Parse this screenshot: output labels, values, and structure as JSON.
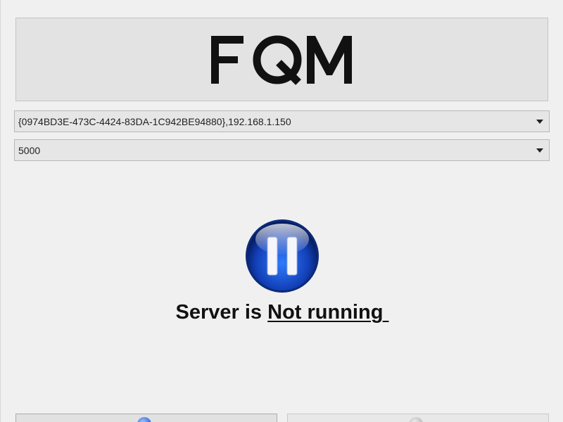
{
  "app": {
    "logo_text": "FQM"
  },
  "adapter_select": {
    "value": "{0974BD3E-473C-4424-83DA-1C942BE94880},192.168.1.150"
  },
  "port_select": {
    "value": "5000"
  },
  "status": {
    "prefix": "Server is ",
    "state": "Not running ",
    "icon": "pause-icon",
    "icon_color": "#1a4fc2"
  },
  "buttons": {
    "start_label": "",
    "stop_label": ""
  }
}
